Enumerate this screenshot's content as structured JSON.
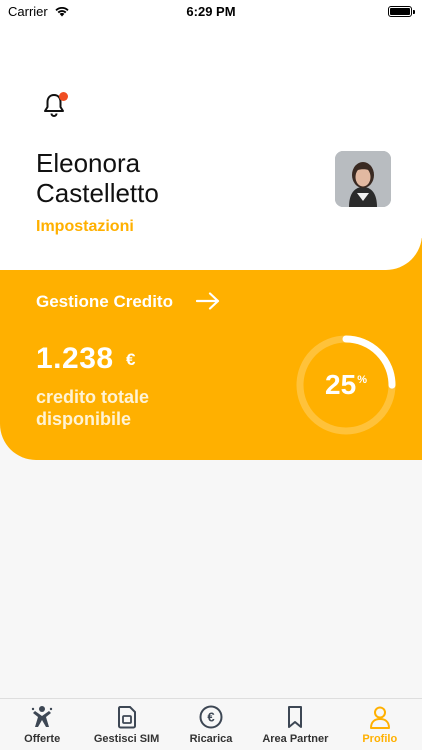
{
  "status_bar": {
    "carrier": "Carrier",
    "time": "6:29 PM"
  },
  "header": {
    "notification_icon": "bell-icon",
    "user": {
      "first_name": "Eleonora",
      "last_name": "Castelletto"
    },
    "settings_label": "Impostazioni"
  },
  "credit": {
    "title": "Gestione Credito",
    "amount": "1.238",
    "currency": "€",
    "label_line1": "credito totale",
    "label_line2": "disponibile",
    "percentage_value": "25",
    "percentage_symbol": "%",
    "progress": 0.25
  },
  "tab_bar": {
    "tabs": [
      {
        "label": "Offerte",
        "icon": "offers-icon",
        "active": false
      },
      {
        "label": "Gestisci SIM",
        "icon": "sim-icon",
        "active": false
      },
      {
        "label": "Ricarica",
        "icon": "euro-icon",
        "active": false
      },
      {
        "label": "Area Partner",
        "icon": "bookmark-icon",
        "active": false
      },
      {
        "label": "Profilo",
        "icon": "user-icon",
        "active": true
      }
    ]
  },
  "colors": {
    "accent": "#ffb000",
    "notification_dot": "#f04e23",
    "background": "#f7f7f7"
  }
}
